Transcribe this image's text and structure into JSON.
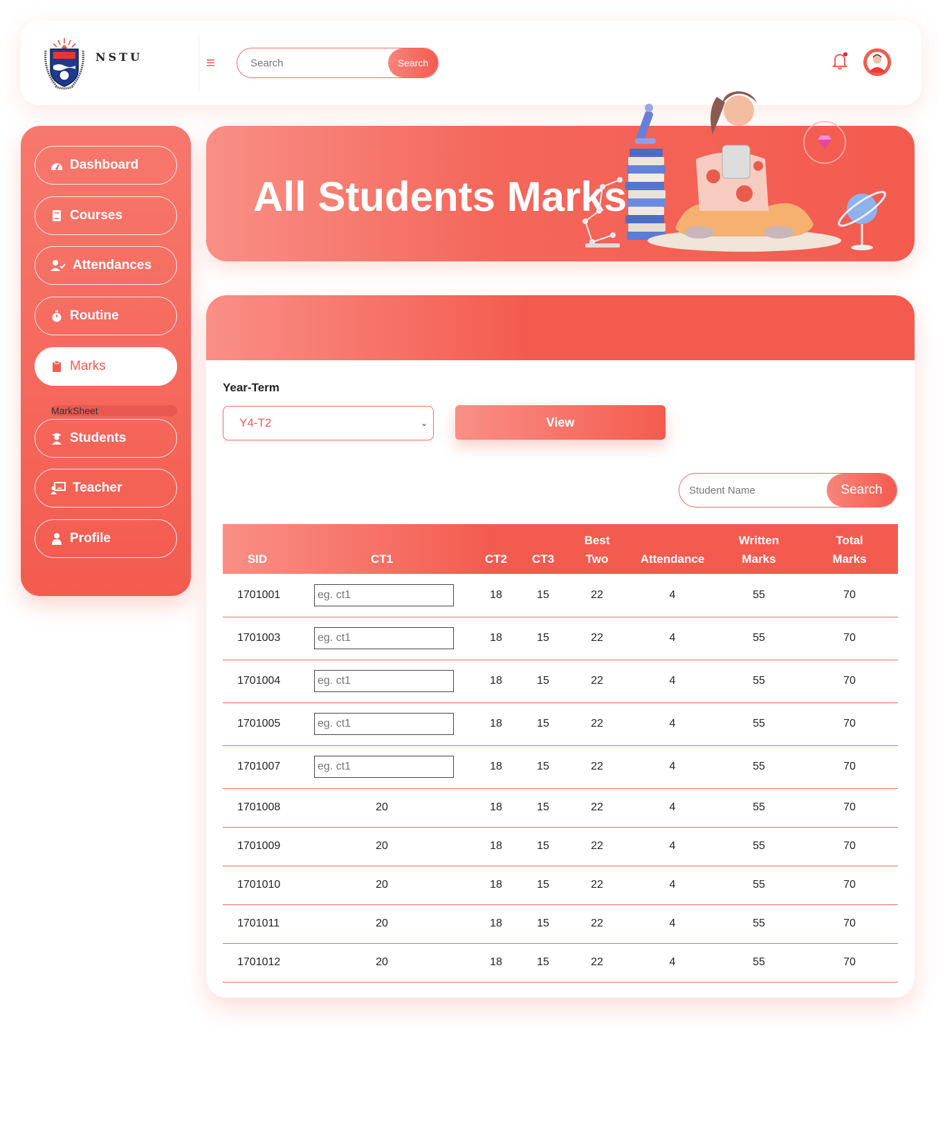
{
  "header": {
    "logo_text": "NSTU",
    "search_placeholder": "Search",
    "search_button": "Search"
  },
  "sidebar": {
    "items": [
      {
        "label": "Dashboard",
        "icon": "dashboard-icon"
      },
      {
        "label": "Courses",
        "icon": "book-icon"
      },
      {
        "label": "Attendances",
        "icon": "user-check-icon"
      },
      {
        "label": "Routine",
        "icon": "stopwatch-icon"
      },
      {
        "label": "Marks",
        "icon": "clipboard-icon"
      },
      {
        "label": "Students",
        "icon": "graduate-icon"
      },
      {
        "label": "Teacher",
        "icon": "teacher-board-icon"
      },
      {
        "label": "Profile",
        "icon": "user-icon"
      }
    ],
    "sub_item": "MarkSheet"
  },
  "banner": {
    "title": "All Students Marks"
  },
  "filter": {
    "year_term_label": "Year-Term",
    "year_term_value": "Y4-T2",
    "view_button": "View",
    "student_search_placeholder": "Student Name",
    "student_search_button": "Search"
  },
  "table": {
    "headers": [
      "SID",
      "CT1",
      "CT2",
      "CT3",
      "Best Two",
      "Attendance",
      "Written Marks",
      "Total Marks"
    ],
    "ct1_placeholder": "eg. ct1",
    "rows": [
      {
        "sid": "1701001",
        "ct1": "",
        "ct2": "18",
        "ct3": "15",
        "best": "22",
        "att": "4",
        "written": "55",
        "total": "70",
        "editable": true
      },
      {
        "sid": "1701003",
        "ct1": "",
        "ct2": "18",
        "ct3": "15",
        "best": "22",
        "att": "4",
        "written": "55",
        "total": "70",
        "editable": true
      },
      {
        "sid": "1701004",
        "ct1": "",
        "ct2": "18",
        "ct3": "15",
        "best": "22",
        "att": "4",
        "written": "55",
        "total": "70",
        "editable": true
      },
      {
        "sid": "1701005",
        "ct1": "",
        "ct2": "18",
        "ct3": "15",
        "best": "22",
        "att": "4",
        "written": "55",
        "total": "70",
        "editable": true
      },
      {
        "sid": "1701007",
        "ct1": "",
        "ct2": "18",
        "ct3": "15",
        "best": "22",
        "att": "4",
        "written": "55",
        "total": "70",
        "editable": true
      },
      {
        "sid": "1701008",
        "ct1": "20",
        "ct2": "18",
        "ct3": "15",
        "best": "22",
        "att": "4",
        "written": "55",
        "total": "70",
        "editable": false
      },
      {
        "sid": "1701009",
        "ct1": "20",
        "ct2": "18",
        "ct3": "15",
        "best": "22",
        "att": "4",
        "written": "55",
        "total": "70",
        "editable": false
      },
      {
        "sid": "1701010",
        "ct1": "20",
        "ct2": "18",
        "ct3": "15",
        "best": "22",
        "att": "4",
        "written": "55",
        "total": "70",
        "editable": false
      },
      {
        "sid": "1701011",
        "ct1": "20",
        "ct2": "18",
        "ct3": "15",
        "best": "22",
        "att": "4",
        "written": "55",
        "total": "70",
        "editable": false
      },
      {
        "sid": "1701012",
        "ct1": "20",
        "ct2": "18",
        "ct3": "15",
        "best": "22",
        "att": "4",
        "written": "55",
        "total": "70",
        "editable": false
      }
    ]
  },
  "colors": {
    "accent": "#f45b4f",
    "accent_light": "#f98f86"
  }
}
